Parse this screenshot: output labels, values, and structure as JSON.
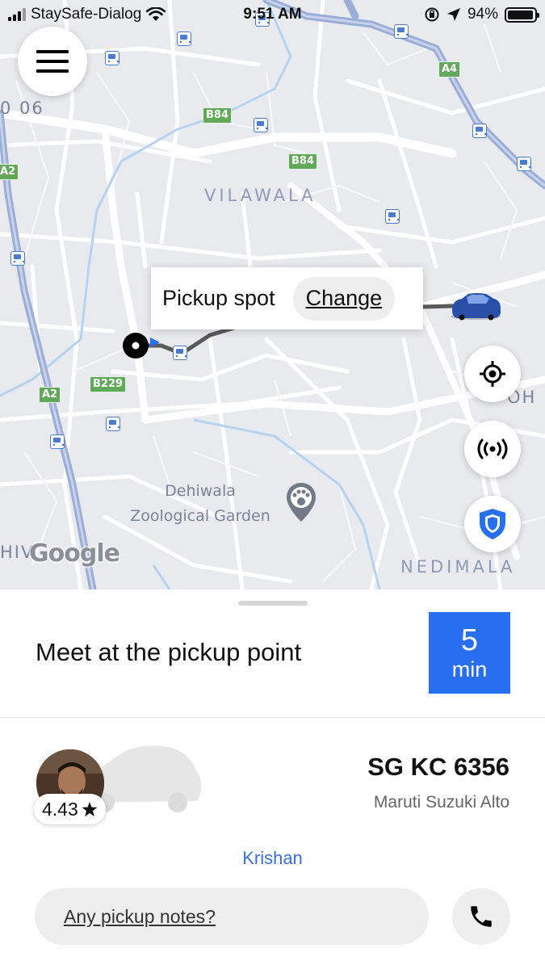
{
  "status_bar": {
    "carrier": "StaySafe-Dialog",
    "time": "9:51 AM",
    "battery": "94%"
  },
  "map": {
    "areas": {
      "vilawala": "VILAWALA",
      "nedimala": "NEDIMALA",
      "edge_left_top": "0 06",
      "edge_right": "OH",
      "edge_left_bottom": "HIV"
    },
    "roads": {
      "b84_a": "B84",
      "b84_b": "B84",
      "a4": "A4",
      "a2_top": "A2",
      "a2_bottom": "A2",
      "b229": "B229"
    },
    "poi": {
      "line1": "Dehiwala",
      "line2": "Zoological Garden"
    },
    "attribution": "Google"
  },
  "pickup_bubble": {
    "label": "Pickup spot",
    "change": "Change"
  },
  "sheet": {
    "title": "Meet at the pickup point",
    "eta_value": "5",
    "eta_unit": "min",
    "rating": "4.43",
    "plate": "SG KC 6356",
    "car_model": "Maruti Suzuki Alto",
    "driver_name": "Krishan",
    "notes_placeholder": "Any pickup notes?"
  },
  "colors": {
    "accent_blue": "#276ef1",
    "driver_link": "#3d6fd6",
    "road_shield": "#62a85a",
    "map_bg": "#e9eaee"
  }
}
